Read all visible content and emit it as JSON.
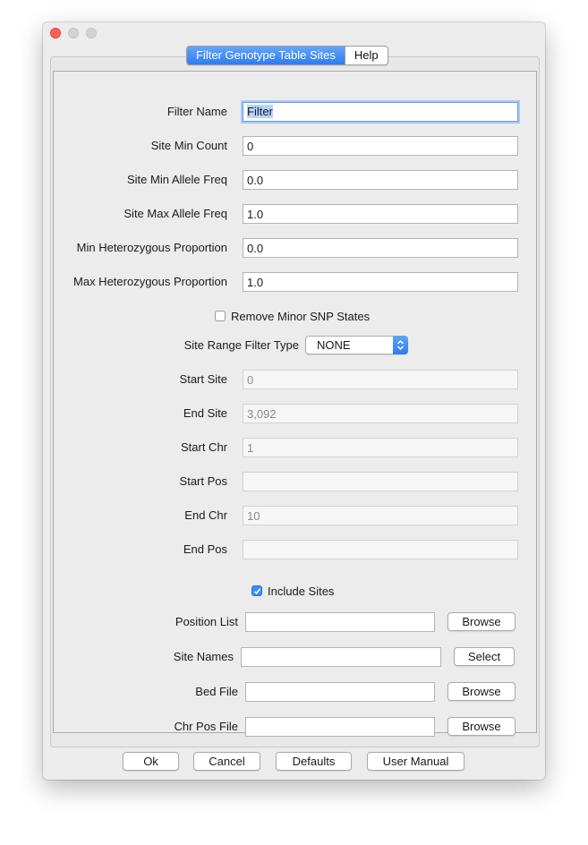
{
  "tabs": [
    {
      "label": "Filter Genotype Table Sites"
    },
    {
      "label": "Help"
    }
  ],
  "fields": {
    "filter_name": {
      "label": "Filter Name",
      "value": "Filter"
    },
    "site_min_count": {
      "label": "Site Min Count",
      "value": "0"
    },
    "site_min_allele_freq": {
      "label": "Site Min Allele Freq",
      "value": "0.0"
    },
    "site_max_allele_freq": {
      "label": "Site Max Allele Freq",
      "value": "1.0"
    },
    "min_het_prop": {
      "label": "Min Heterozygous Proportion",
      "value": "0.0"
    },
    "max_het_prop": {
      "label": "Max Heterozygous Proportion",
      "value": "1.0"
    },
    "start_site": {
      "label": "Start Site",
      "value": "0"
    },
    "end_site": {
      "label": "End Site",
      "value": "3,092"
    },
    "start_chr": {
      "label": "Start Chr",
      "value": "1"
    },
    "start_pos": {
      "label": "Start Pos",
      "value": ""
    },
    "end_chr": {
      "label": "End Chr",
      "value": "10"
    },
    "end_pos": {
      "label": "End Pos",
      "value": ""
    },
    "position_list": {
      "label": "Position List",
      "value": ""
    },
    "site_names": {
      "label": "Site Names",
      "value": ""
    },
    "bed_file": {
      "label": "Bed File",
      "value": ""
    },
    "chr_pos_file": {
      "label": "Chr Pos File",
      "value": ""
    }
  },
  "remove_minor_snp": {
    "label": "Remove Minor SNP States",
    "checked": false
  },
  "range_filter": {
    "label": "Site Range Filter Type",
    "selected": "NONE"
  },
  "include_sites": {
    "label": "Include Sites",
    "checked": true
  },
  "file_buttons": {
    "browse": "Browse",
    "select": "Select"
  },
  "footer": {
    "ok": "Ok",
    "cancel": "Cancel",
    "defaults": "Defaults",
    "manual": "User Manual"
  },
  "colors": {
    "accent": "#3b8df6",
    "close": "#ff5f57"
  }
}
